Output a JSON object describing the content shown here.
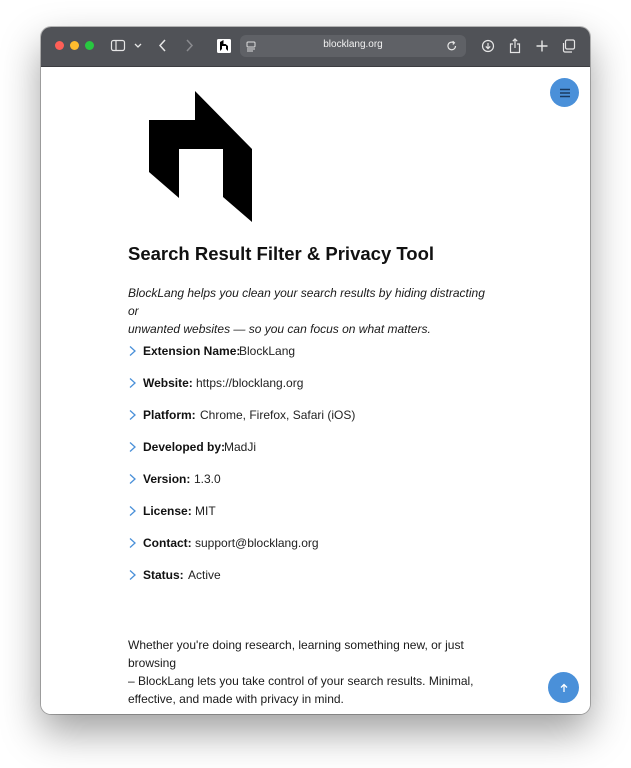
{
  "browser": {
    "url": "blocklang.org",
    "icons": [
      "close-window",
      "minimize-window",
      "maximize-window",
      "sidebar-icon",
      "chevron-down-icon",
      "back-icon",
      "forward-icon",
      "site-favicon",
      "reader-icon",
      "reload-icon",
      "download-icon",
      "share-icon",
      "new-tab-icon",
      "tab-overview-icon"
    ]
  },
  "page": {
    "title": "Search Result Filter & Privacy Tool",
    "intro_line1": "BlockLang helps you clean your search results by hiding distracting or",
    "intro_line2": "unwanted websites — so you can focus on what matters.",
    "details": [
      {
        "label": "Extension Name:",
        "value": "BlockLang"
      },
      {
        "label": "Website:",
        "value": "https://blocklang.org"
      },
      {
        "label": "Platform:",
        "value": "Chrome, Firefox, Safari (iOS)"
      },
      {
        "label": "Developed by:",
        "value": "MadJi"
      },
      {
        "label": "Version:",
        "value": "1.3.0"
      },
      {
        "label": "License:",
        "value": "MIT"
      },
      {
        "label": "Contact:",
        "value": "support@blocklang.org"
      },
      {
        "label": "Status:",
        "value": "Active"
      }
    ],
    "closing_line1": "Whether you're doing research, learning something new, or just browsing",
    "closing_line2": "– BlockLang lets you take control of your search results. Minimal,",
    "closing_line3": "effective, and made with privacy in mind."
  },
  "colors": {
    "accent": "#4a90d9",
    "toolbar": "#505257",
    "chevron": "#4a90d9"
  }
}
